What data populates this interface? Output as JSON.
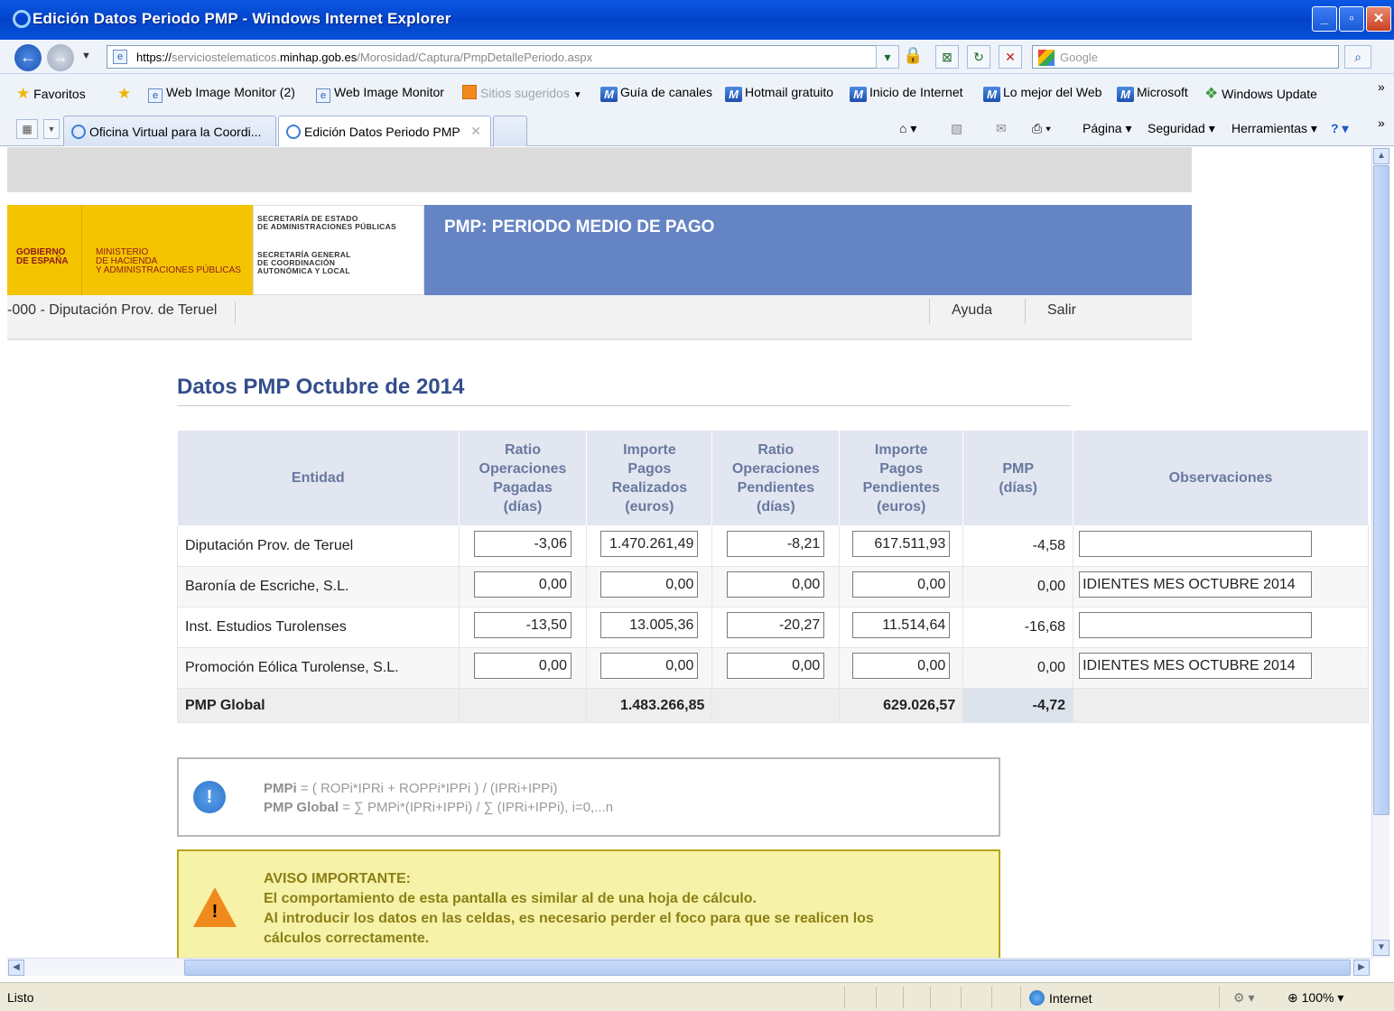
{
  "window": {
    "title": "Edición Datos Periodo PMP - Windows Internet Explorer",
    "min_glyph": "_",
    "max_glyph": "▫",
    "close_glyph": "✕"
  },
  "address": {
    "url_prefix": "https://",
    "url_sub": "serviciostelematicos.",
    "url_host": "minhap.gob.es",
    "url_path": "/Morosidad/Captura/PmpDetallePeriodo.aspx",
    "search_placeholder": "Google"
  },
  "favorites": {
    "label": "Favoritos",
    "items": [
      {
        "label": "Web Image Monitor (2)",
        "icon": "ie-page-icon"
      },
      {
        "label": "Web Image Monitor",
        "icon": "ie-page-icon"
      },
      {
        "label": "Sitios sugeridos",
        "icon": "suggested-sites-icon"
      },
      {
        "label": "Guía de canales",
        "icon": "msn-icon"
      },
      {
        "label": "Hotmail gratuito",
        "icon": "msn-icon"
      },
      {
        "label": "Inicio de Internet",
        "icon": "msn-icon"
      },
      {
        "label": "Lo mejor del Web",
        "icon": "msn-icon"
      },
      {
        "label": "Microsoft",
        "icon": "msn-icon"
      },
      {
        "label": "Windows Update",
        "icon": "windows-icon"
      }
    ],
    "more": "»"
  },
  "tabs": [
    {
      "label": "Oficina Virtual para la Coordi...",
      "active": false
    },
    {
      "label": "Edición Datos Periodo PMP",
      "active": true
    }
  ],
  "commandbar": {
    "page": "Página",
    "security": "Seguridad",
    "tools": "Herramientas",
    "more": "»"
  },
  "header": {
    "gobierno": "GOBIERNO\nDE ESPAÑA",
    "ministerio": "MINISTERIO\nDE HACIENDA\nY ADMINISTRACIONES PÚBLICAS",
    "sec1": "SECRETARÍA DE ESTADO\nDE ADMINISTRACIONES PÚBLICAS",
    "sec2": "SECRETARÍA GENERAL\nDE COORDINACIÓN\nAUTONÓMICA Y LOCAL",
    "banner_title": "PMP: PERIODO MEDIO DE PAGO"
  },
  "userbar": {
    "entity": "-000 - Diputación Prov. de Teruel",
    "help": "Ayuda",
    "exit": "Salir"
  },
  "page_title": "Datos PMP Octubre de 2014",
  "table": {
    "headers": {
      "entidad": "Entidad",
      "ratio_pagadas": "Ratio\nOperaciones\nPagadas\n(días)",
      "importe_realizados": "Importe\nPagos\nRealizados\n(euros)",
      "ratio_pendientes": "Ratio\nOperaciones\nPendientes\n(días)",
      "importe_pendientes": "Importe\nPagos\nPendientes\n(euros)",
      "pmp": "PMP\n(días)",
      "observaciones": "Observaciones"
    },
    "rows": [
      {
        "entidad": "Diputación Prov. de Teruel",
        "ratio_pagadas": "-3,06",
        "importe_realizados": "1.470.261,49",
        "ratio_pendientes": "-8,21",
        "importe_pendientes": "617.511,93",
        "pmp": "-4,58",
        "observaciones": ""
      },
      {
        "entidad": "Baronía de Escriche, S.L.",
        "ratio_pagadas": "0,00",
        "importe_realizados": "0,00",
        "ratio_pendientes": "0,00",
        "importe_pendientes": "0,00",
        "pmp": "0,00",
        "observaciones": "IDIENTES MES OCTUBRE 2014"
      },
      {
        "entidad": "Inst. Estudios Turolenses",
        "ratio_pagadas": "-13,50",
        "importe_realizados": "13.005,36",
        "ratio_pendientes": "-20,27",
        "importe_pendientes": "11.514,64",
        "pmp": "-16,68",
        "observaciones": ""
      },
      {
        "entidad": "Promoción Eólica Turolense, S.L.",
        "ratio_pagadas": "0,00",
        "importe_realizados": "0,00",
        "ratio_pendientes": "0,00",
        "importe_pendientes": "0,00",
        "pmp": "0,00",
        "observaciones": "IDIENTES MES OCTUBRE 2014"
      }
    ],
    "total": {
      "label": "PMP Global",
      "importe_realizados": "1.483.266,85",
      "importe_pendientes": "629.026,57",
      "pmp": "-4,72"
    }
  },
  "info": {
    "l1_bold": "PMPi",
    "l1_rest": " = ( ROPi*IPRi + ROPPi*IPPi ) / (IPRi+IPPi)",
    "l2_bold": "PMP Global",
    "l2_rest": " = ∑ PMPi*(IPRi+IPPi) / ∑ (IPRi+IPPi), i=0,...n"
  },
  "warning": {
    "title": "AVISO IMPORTANTE:",
    "line1": "El comportamiento de esta pantalla es similar al de una hoja de cálculo.",
    "line2": "Al introducir los datos en las celdas, es necesario perder el foco para que se realicen los",
    "line3": "cálculos correctamente."
  },
  "status": {
    "text": "Listo",
    "zone": "Internet",
    "zoom": "100%"
  }
}
